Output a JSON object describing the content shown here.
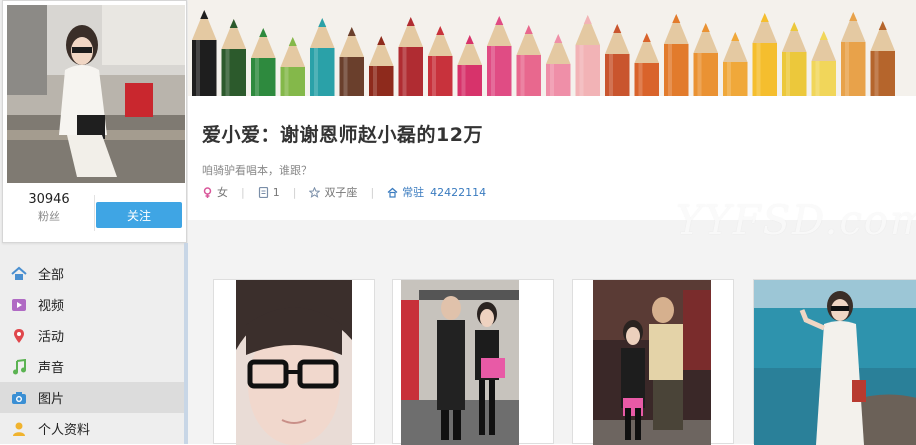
{
  "profile": {
    "followers_count": "30946",
    "followers_label": "粉丝",
    "follow_label": "关注",
    "title": "爱小爱：谢谢恩师赵小磊的12万",
    "bio": "咱骑驴看唱本，谁跟？",
    "gender": "女",
    "count": "1",
    "zodiac": "双子座",
    "resident_label": "常驻",
    "resident_id": "42422114"
  },
  "nav": {
    "items": [
      {
        "label": "全部",
        "icon": "home-icon"
      },
      {
        "label": "视频",
        "icon": "video-icon"
      },
      {
        "label": "活动",
        "icon": "location-pin-icon"
      },
      {
        "label": "声音",
        "icon": "music-note-icon"
      },
      {
        "label": "图片",
        "icon": "camera-icon",
        "active": true
      },
      {
        "label": "个人资料",
        "icon": "person-icon"
      }
    ]
  },
  "watermark": "YYFSD.com",
  "colors": {
    "follow_button": "#3fa5e4",
    "link": "#3a7bbf",
    "active_nav": "#dcdcdc"
  }
}
